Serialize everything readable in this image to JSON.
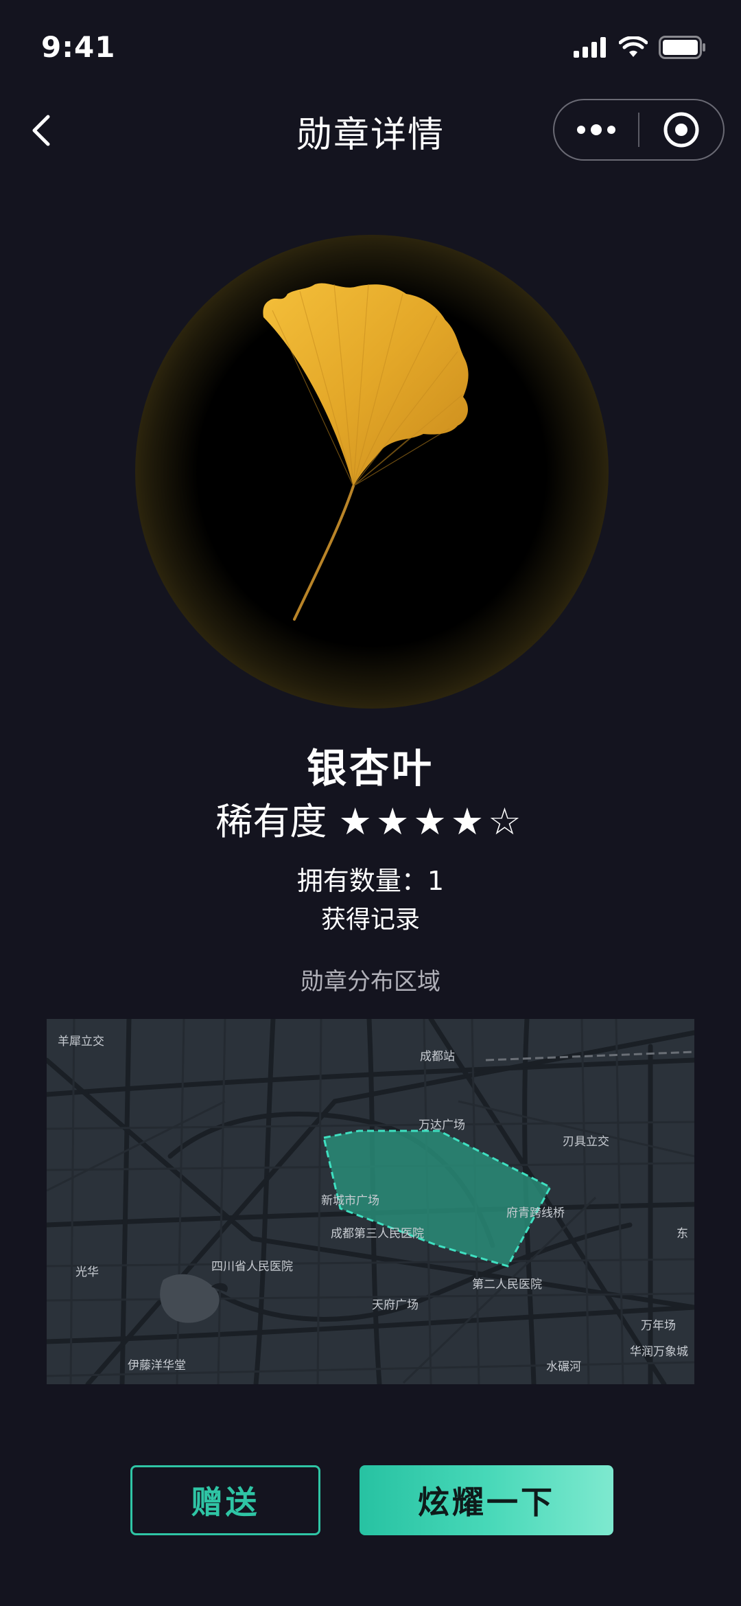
{
  "status_bar": {
    "time": "9:41"
  },
  "nav": {
    "title": "勋章详情"
  },
  "badge": {
    "name": "银杏叶",
    "rarity_label": "稀有度",
    "rarity_stars": "★★★★☆",
    "rarity_value": 4,
    "rarity_max": 5,
    "owned_text": "拥有数量：1",
    "record_link": "获得记录"
  },
  "map_section": {
    "title": "勋章分布区域",
    "labels": [
      "羊犀立交",
      "成都站",
      "万达广场",
      "刃具立交",
      "新城市广场",
      "府青跨线桥",
      "成都第三人民医院",
      "东",
      "光华",
      "四川省人民医院",
      "第二人民医院",
      "天府广场",
      "万年场",
      "华润万象城",
      "伊藤洋华堂",
      "水碾河"
    ]
  },
  "actions": {
    "gift_label": "赠送",
    "show_label": "炫耀一下"
  },
  "colors": {
    "accent": "#2fc5a5",
    "background": "#14141f",
    "leaf": "#e3a728"
  }
}
